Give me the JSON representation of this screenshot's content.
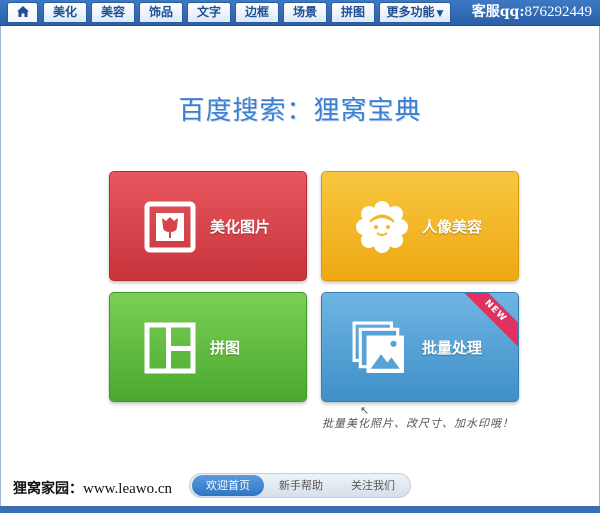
{
  "tabs": [
    {
      "id": "home",
      "label": ""
    },
    {
      "id": "beautify",
      "label": "美化"
    },
    {
      "id": "makeup",
      "label": "美容"
    },
    {
      "id": "accessories",
      "label": "饰品"
    },
    {
      "id": "text",
      "label": "文字"
    },
    {
      "id": "border",
      "label": "边框"
    },
    {
      "id": "scene",
      "label": "场景"
    },
    {
      "id": "collage",
      "label": "拼图"
    },
    {
      "id": "more",
      "label": "更多功能"
    }
  ],
  "service": {
    "label": "客服qq:",
    "number": "876292449"
  },
  "headline": "百度搜索：狸窝宝典",
  "tiles": {
    "beautify": {
      "label": "美化图片"
    },
    "portrait": {
      "label": "人像美容"
    },
    "collage": {
      "label": "拼图"
    },
    "batch": {
      "label": "批量处理",
      "badge": "NEW"
    }
  },
  "note": "批量美化照片、改尺寸、加水印哦！",
  "footer": {
    "site_label": "狸窝家园：",
    "site_url": "www.leawo.cn",
    "nav": [
      "欢迎首页",
      "新手帮助",
      "关注我们"
    ]
  },
  "colors": {
    "accent": "#2a5fa8",
    "beautify": "#d6434a",
    "portrait": "#f3b82a",
    "collage": "#5fbb3f",
    "batch": "#55a2d6"
  }
}
